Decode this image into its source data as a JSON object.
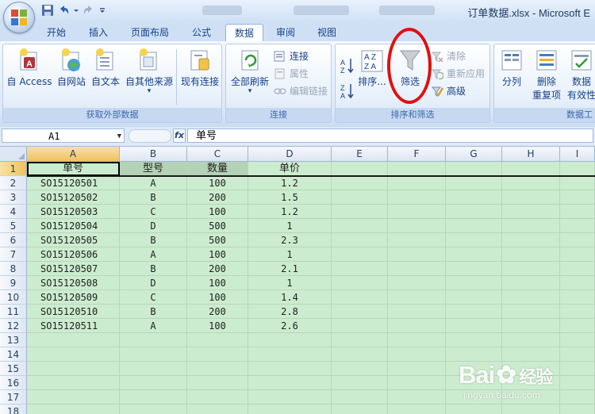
{
  "window": {
    "title": "订单数据.xlsx - Microsoft E"
  },
  "tabs": [
    "开始",
    "插入",
    "页面布局",
    "公式",
    "数据",
    "审阅",
    "视图"
  ],
  "active_tab": "数据",
  "ribbon": {
    "get_external": {
      "label": "获取外部数据",
      "buttons": [
        "自 Access",
        "自网站",
        "自文本",
        "自其他来源",
        "现有连接"
      ]
    },
    "connections": {
      "label": "连接",
      "refresh_all": "全部刷新",
      "small": [
        "连接",
        "属性",
        "编辑链接"
      ]
    },
    "sort_filter": {
      "label": "排序和筛选",
      "sort": "排序...",
      "filter": "筛选",
      "small": [
        "清除",
        "重新应用",
        "高级"
      ]
    },
    "data_tools": {
      "label": "数据工",
      "split": "分列",
      "remove_dup_1": "删除",
      "remove_dup_2": "重复项",
      "validation_1": "数据",
      "validation_2": "有效性"
    }
  },
  "formula_bar": {
    "name_box": "A1",
    "fx": "fx",
    "content": "单号"
  },
  "sheet": {
    "columns": [
      "A",
      "B",
      "C",
      "D",
      "E",
      "F",
      "G",
      "H",
      "I"
    ],
    "rows": [
      "1",
      "2",
      "3",
      "4",
      "5",
      "6",
      "7",
      "8",
      "9",
      "10",
      "11",
      "12",
      "13",
      "14",
      "15",
      "16",
      "17",
      "18"
    ],
    "headers": [
      "单号",
      "型号",
      "数量",
      "单价"
    ],
    "data": [
      [
        "SO15120501",
        "A",
        "100",
        "1.2"
      ],
      [
        "SO15120502",
        "B",
        "200",
        "1.5"
      ],
      [
        "SO15120503",
        "C",
        "100",
        "1.2"
      ],
      [
        "SO15120504",
        "D",
        "500",
        "1"
      ],
      [
        "SO15120505",
        "B",
        "500",
        "2.3"
      ],
      [
        "SO15120506",
        "A",
        "100",
        "1"
      ],
      [
        "SO15120507",
        "B",
        "200",
        "2.1"
      ],
      [
        "SO15120508",
        "D",
        "100",
        "1"
      ],
      [
        "SO15120509",
        "C",
        "100",
        "1.4"
      ],
      [
        "SO15120510",
        "B",
        "200",
        "2.8"
      ],
      [
        "SO15120511",
        "A",
        "100",
        "2.6"
      ]
    ]
  },
  "watermark": {
    "brand": "Bai",
    "brand2": "经验",
    "url": "jingyan.baidu.com"
  },
  "colors": {
    "sheet_background": "#cceccf",
    "annotation_circle": "#e01010",
    "ribbon_text": "#15428b"
  }
}
